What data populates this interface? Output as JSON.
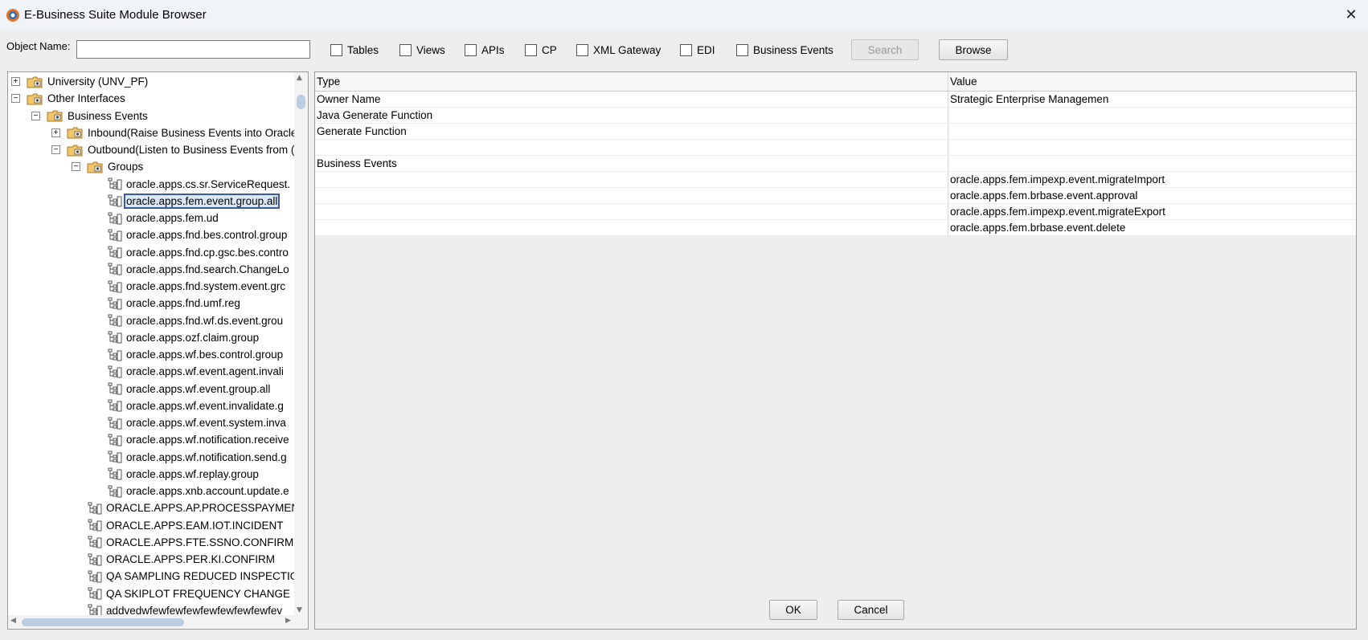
{
  "window": {
    "title": "E-Business Suite Module Browser",
    "close_glyph": "✕"
  },
  "search": {
    "object_name_label": "Object Name:",
    "object_name_value": "",
    "checkboxes": [
      {
        "label": "Tables",
        "checked": false
      },
      {
        "label": "Views",
        "checked": false
      },
      {
        "label": "APIs",
        "checked": false
      },
      {
        "label": "CP",
        "checked": false
      },
      {
        "label": "XML Gateway",
        "checked": false
      },
      {
        "label": "EDI",
        "checked": false
      },
      {
        "label": "Business Events",
        "checked": false
      }
    ],
    "search_button": "Search",
    "browse_button": "Browse"
  },
  "tree": {
    "nodes": [
      {
        "label": "University (UNV_PF)",
        "expander": "+",
        "type": "folder"
      },
      {
        "label": "Other Interfaces",
        "expander": "−",
        "type": "folder"
      },
      {
        "label": "Business Events",
        "expander": "−",
        "type": "folder"
      },
      {
        "label": "Inbound(Raise Business Events into Oracle",
        "expander": "+",
        "type": "folder"
      },
      {
        "label": "Outbound(Listen to Business Events from (",
        "expander": "−",
        "type": "folder"
      },
      {
        "label": "Groups",
        "expander": "−",
        "type": "folder"
      },
      {
        "label": "oracle.apps.cs.sr.ServiceRequest.",
        "type": "leaf"
      },
      {
        "label": "oracle.apps.fem.event.group.all",
        "type": "leaf",
        "selected": true
      },
      {
        "label": "oracle.apps.fem.ud",
        "type": "leaf"
      },
      {
        "label": "oracle.apps.fnd.bes.control.group",
        "type": "leaf"
      },
      {
        "label": "oracle.apps.fnd.cp.gsc.bes.contro",
        "type": "leaf"
      },
      {
        "label": "oracle.apps.fnd.search.ChangeLo",
        "type": "leaf"
      },
      {
        "label": "oracle.apps.fnd.system.event.grc",
        "type": "leaf"
      },
      {
        "label": "oracle.apps.fnd.umf.reg",
        "type": "leaf"
      },
      {
        "label": "oracle.apps.fnd.wf.ds.event.grou",
        "type": "leaf"
      },
      {
        "label": "oracle.apps.ozf.claim.group",
        "type": "leaf"
      },
      {
        "label": "oracle.apps.wf.bes.control.group",
        "type": "leaf"
      },
      {
        "label": "oracle.apps.wf.event.agent.invali",
        "type": "leaf"
      },
      {
        "label": "oracle.apps.wf.event.group.all",
        "type": "leaf"
      },
      {
        "label": "oracle.apps.wf.event.invalidate.g",
        "type": "leaf"
      },
      {
        "label": "oracle.apps.wf.event.system.inva",
        "type": "leaf"
      },
      {
        "label": "oracle.apps.wf.notification.receive",
        "type": "leaf"
      },
      {
        "label": "oracle.apps.wf.notification.send.g",
        "type": "leaf"
      },
      {
        "label": "oracle.apps.wf.replay.group",
        "type": "leaf"
      },
      {
        "label": "oracle.apps.xnb.account.update.e",
        "type": "leaf"
      },
      {
        "label": "ORACLE.APPS.AP.PROCESSPAYMENT.",
        "type": "leaf"
      },
      {
        "label": "ORACLE.APPS.EAM.IOT.INCIDENT",
        "type": "leaf"
      },
      {
        "label": "ORACLE.APPS.FTE.SSNO.CONFIRM",
        "type": "leaf"
      },
      {
        "label": "ORACLE.APPS.PER.KI.CONFIRM",
        "type": "leaf"
      },
      {
        "label": "QA SAMPLING REDUCED INSPECTION",
        "type": "leaf"
      },
      {
        "label": "QA SKIPLOT FREQUENCY CHANGE",
        "type": "leaf"
      },
      {
        "label": "addvedwfewfewfewfewfewfewfewfev",
        "type": "leaf"
      }
    ]
  },
  "properties": {
    "header": {
      "type": "Type",
      "value": "Value"
    },
    "rows": [
      {
        "type": "Owner Name",
        "value": "Strategic Enterprise Managemen"
      },
      {
        "type": "Java Generate Function",
        "value": ""
      },
      {
        "type": "Generate Function",
        "value": ""
      },
      {
        "type": "",
        "value": ""
      },
      {
        "type": "Business Events",
        "value": ""
      },
      {
        "type": "",
        "value": "oracle.apps.fem.impexp.event.migrateImport"
      },
      {
        "type": "",
        "value": "oracle.apps.fem.brbase.event.approval"
      },
      {
        "type": "",
        "value": "oracle.apps.fem.impexp.event.migrateExport"
      },
      {
        "type": "",
        "value": "oracle.apps.fem.brbase.event.delete"
      }
    ]
  },
  "footer": {
    "ok_button": "OK",
    "cancel_button": "Cancel"
  }
}
